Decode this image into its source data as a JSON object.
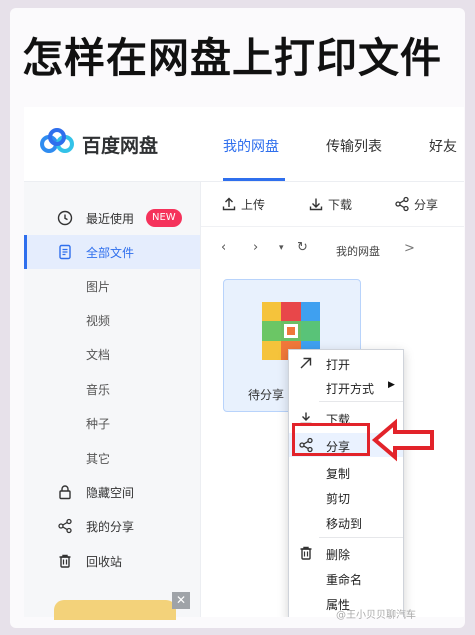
{
  "headline": "怎样在网盘上打印文件",
  "app": {
    "name": "百度网盘",
    "tabs": [
      {
        "label": "我的网盘",
        "active": true
      },
      {
        "label": "传输列表",
        "active": false
      },
      {
        "label": "好友",
        "active": false
      }
    ]
  },
  "sidebar": {
    "items": [
      {
        "label": "最近使用",
        "icon": "clock-icon",
        "badge": "NEW"
      },
      {
        "label": "全部文件",
        "icon": "document-icon",
        "active": true
      },
      {
        "label": "图片"
      },
      {
        "label": "视频"
      },
      {
        "label": "文档"
      },
      {
        "label": "音乐"
      },
      {
        "label": "种子"
      },
      {
        "label": "其它"
      },
      {
        "label": "隐藏空间",
        "icon": "lock-icon"
      },
      {
        "label": "我的分享",
        "icon": "share-icon"
      },
      {
        "label": "回收站",
        "icon": "trash-icon"
      }
    ]
  },
  "toolbar": {
    "upload": "上传",
    "download": "下载",
    "share": "分享"
  },
  "pathbar": {
    "crumb": "我的网盘",
    "sep": ">"
  },
  "file": {
    "name": "待分享"
  },
  "context_menu": {
    "items": [
      {
        "label": "打开",
        "icon": "open-arrow-icon"
      },
      {
        "label": "打开方式",
        "submenu": true
      },
      {
        "label": "下载",
        "icon": "download-icon"
      },
      {
        "label": "分享",
        "icon": "share-icon",
        "highlighted": true
      },
      {
        "label": "复制"
      },
      {
        "label": "剪切"
      },
      {
        "label": "移动到"
      },
      {
        "label": "删除",
        "icon": "trash-icon"
      },
      {
        "label": "重命名"
      },
      {
        "label": "属性"
      }
    ]
  },
  "watermark": "@王小贝贝聊汽车",
  "colors": {
    "accent": "#2f6fed",
    "highlight_box": "#e2232a",
    "badge": "#f5325b"
  }
}
